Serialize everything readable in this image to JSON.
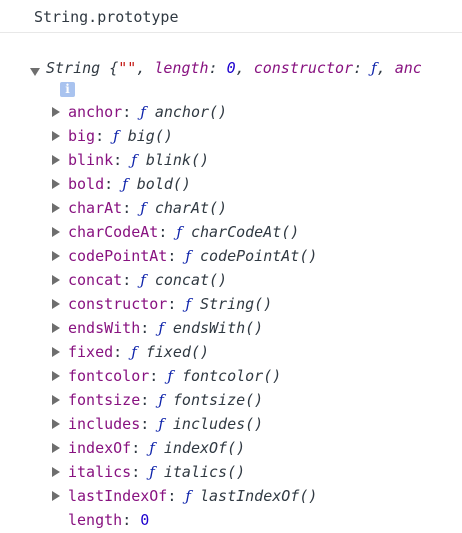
{
  "console": {
    "input": "String.prototype",
    "summary": {
      "prefix": "String {",
      "string_literal": "\"\"",
      "sep1": ", ",
      "length_key": "length",
      "colon1": ": ",
      "length_value": "0",
      "sep2": ", ",
      "constructor_key": "constructor",
      "colon2": ": ",
      "constructor_value": "ƒ",
      "sep3": ", ",
      "truncated": "anc"
    },
    "info_badge": "i",
    "properties": [
      {
        "name": "anchor",
        "f": "ƒ",
        "value": "anchor()"
      },
      {
        "name": "big",
        "f": "ƒ",
        "value": "big()"
      },
      {
        "name": "blink",
        "f": "ƒ",
        "value": "blink()"
      },
      {
        "name": "bold",
        "f": "ƒ",
        "value": "bold()"
      },
      {
        "name": "charAt",
        "f": "ƒ",
        "value": "charAt()"
      },
      {
        "name": "charCodeAt",
        "f": "ƒ",
        "value": "charCodeAt()"
      },
      {
        "name": "codePointAt",
        "f": "ƒ",
        "value": "codePointAt()"
      },
      {
        "name": "concat",
        "f": "ƒ",
        "value": "concat()"
      },
      {
        "name": "constructor",
        "f": "ƒ",
        "value": "String()"
      },
      {
        "name": "endsWith",
        "f": "ƒ",
        "value": "endsWith()"
      },
      {
        "name": "fixed",
        "f": "ƒ",
        "value": "fixed()"
      },
      {
        "name": "fontcolor",
        "f": "ƒ",
        "value": "fontcolor()"
      },
      {
        "name": "fontsize",
        "f": "ƒ",
        "value": "fontsize()"
      },
      {
        "name": "includes",
        "f": "ƒ",
        "value": "includes()"
      },
      {
        "name": "indexOf",
        "f": "ƒ",
        "value": "indexOf()"
      },
      {
        "name": "italics",
        "f": "ƒ",
        "value": "italics()"
      },
      {
        "name": "lastIndexOf",
        "f": "ƒ",
        "value": "lastIndexOf()"
      }
    ],
    "length_row": {
      "name": "length",
      "value": "0"
    },
    "colon": ": ",
    "colors": {
      "property_name": "#881280",
      "function_f": "#0d22aa",
      "number": "#1c00cf",
      "string": "#c41a16",
      "info_badge_bg": "#a9c3ef"
    }
  }
}
